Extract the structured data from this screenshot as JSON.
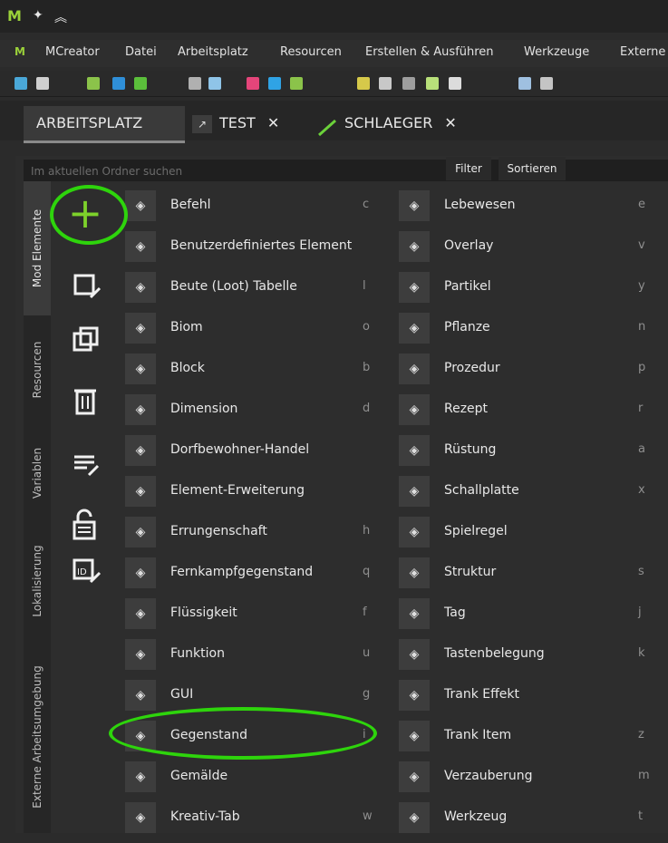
{
  "titlebar": {
    "logo": "M̷",
    "pin_icon": "pin-icon",
    "collapse_icon": "chevrons-up-icon"
  },
  "menu": {
    "items": [
      "MCreator",
      "Datei",
      "Arbeitsplatz",
      "Resourcen",
      "Erstellen & Ausführen",
      "Werkzeuge",
      "Externe"
    ]
  },
  "tabs": [
    {
      "label": "ARBEITSPLATZ"
    },
    {
      "label": "TEST",
      "close": "✕"
    },
    {
      "label": "SCHLAEGER",
      "close": "✕"
    }
  ],
  "search": {
    "placeholder": "Im aktuellen Ordner suchen",
    "filter_label": "Filter",
    "sort_label": "Sortieren"
  },
  "vtabs": [
    "Mod Elemente",
    "Resourcen",
    "Variablen",
    "Lokalisierung",
    "Externe Arbeitsumgebung"
  ],
  "left_column": [
    {
      "label": "Befehl",
      "key": "c",
      "icon": "command-icon"
    },
    {
      "label": "Benutzerdefiniertes Element",
      "key": "",
      "icon": "custom-element-icon"
    },
    {
      "label": "Beute (Loot) Tabelle",
      "key": "l",
      "icon": "loot-table-icon"
    },
    {
      "label": "Biom",
      "key": "o",
      "icon": "biome-icon"
    },
    {
      "label": "Block",
      "key": "b",
      "icon": "block-icon"
    },
    {
      "label": "Dimension",
      "key": "d",
      "icon": "dimension-icon"
    },
    {
      "label": "Dorfbewohner-Handel",
      "key": "",
      "icon": "villager-trade-icon"
    },
    {
      "label": "Element-Erweiterung",
      "key": "",
      "icon": "element-extension-icon"
    },
    {
      "label": "Errungenschaft",
      "key": "h",
      "icon": "achievement-icon"
    },
    {
      "label": "Fernkampfgegenstand",
      "key": "q",
      "icon": "ranged-item-icon"
    },
    {
      "label": "Flüssigkeit",
      "key": "f",
      "icon": "fluid-icon"
    },
    {
      "label": "Funktion",
      "key": "u",
      "icon": "function-icon"
    },
    {
      "label": "GUI",
      "key": "g",
      "icon": "gui-icon"
    },
    {
      "label": "Gegenstand",
      "key": "i",
      "icon": "item-icon"
    },
    {
      "label": "Gemälde",
      "key": "",
      "icon": "painting-icon"
    },
    {
      "label": "Kreativ-Tab",
      "key": "w",
      "icon": "creative-tab-icon"
    }
  ],
  "right_column": [
    {
      "label": "Lebewesen",
      "key": "e",
      "icon": "living-entity-icon"
    },
    {
      "label": "Overlay",
      "key": "v",
      "icon": "overlay-icon"
    },
    {
      "label": "Partikel",
      "key": "y",
      "icon": "particle-icon"
    },
    {
      "label": "Pflanze",
      "key": "n",
      "icon": "plant-icon"
    },
    {
      "label": "Prozedur",
      "key": "p",
      "icon": "procedure-icon"
    },
    {
      "label": "Rezept",
      "key": "r",
      "icon": "recipe-icon"
    },
    {
      "label": "Rüstung",
      "key": "a",
      "icon": "armor-icon"
    },
    {
      "label": "Schallplatte",
      "key": "x",
      "icon": "music-disc-icon"
    },
    {
      "label": "Spielregel",
      "key": "",
      "icon": "gamerule-icon"
    },
    {
      "label": "Struktur",
      "key": "s",
      "icon": "structure-icon"
    },
    {
      "label": "Tag",
      "key": "j",
      "icon": "tag-icon"
    },
    {
      "label": "Tastenbelegung",
      "key": "k",
      "icon": "keybind-icon"
    },
    {
      "label": "Trank Effekt",
      "key": "",
      "icon": "potion-effect-icon"
    },
    {
      "label": "Trank Item",
      "key": "z",
      "icon": "potion-item-icon"
    },
    {
      "label": "Verzauberung",
      "key": "m",
      "icon": "enchantment-icon"
    },
    {
      "label": "Werkzeug",
      "key": "t",
      "icon": "tool-icon"
    }
  ],
  "tools": [
    {
      "name": "add-element-icon"
    },
    {
      "name": "edit-element-icon"
    },
    {
      "name": "duplicate-element-icon"
    },
    {
      "name": "delete-element-icon"
    },
    {
      "name": "code-edit-icon"
    },
    {
      "name": "lock-icon"
    },
    {
      "name": "id-edit-icon"
    }
  ],
  "colors": {
    "accent": "#7dd22b",
    "highlight": "#2ed40c",
    "background": "#2b2b2b"
  }
}
